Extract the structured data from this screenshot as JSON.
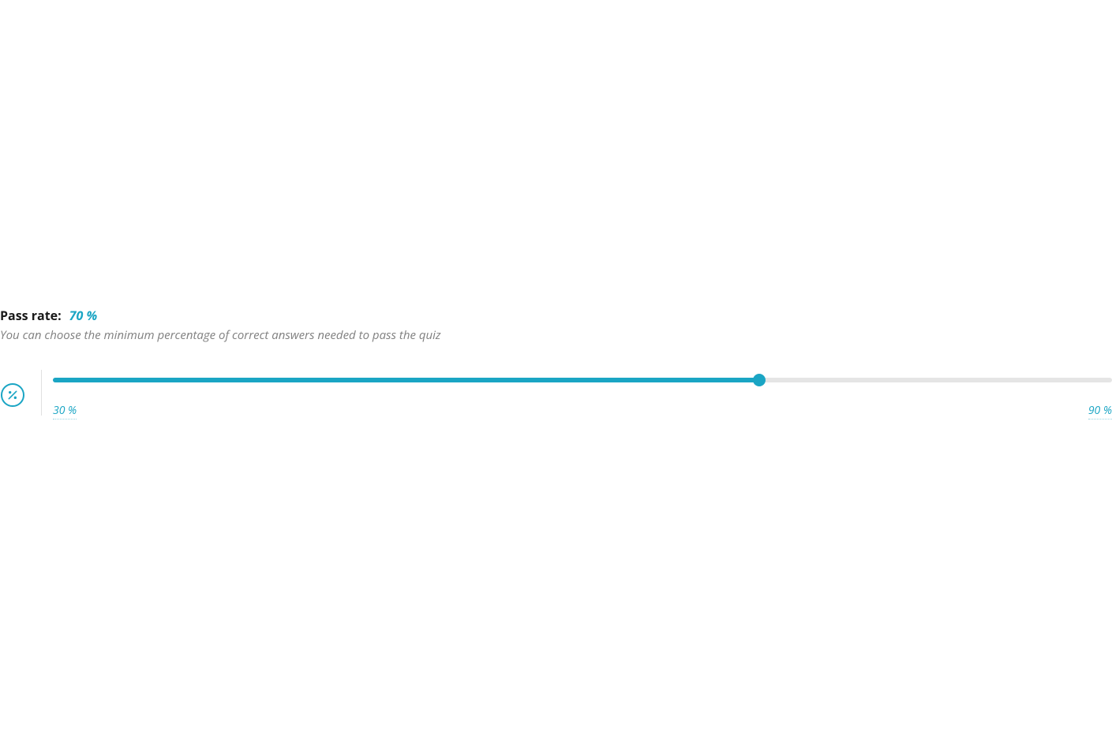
{
  "passRate": {
    "label": "Pass rate:",
    "value": "70 %",
    "description": "You can choose the minimum percentage of correct answers needed to pass the quiz",
    "slider": {
      "min": 30,
      "max": 90,
      "current": 70,
      "minLabel": "30 %",
      "maxLabel": "90 %",
      "fillPercent": 66.67
    }
  },
  "colors": {
    "accent": "#1aa5c4",
    "trackEmpty": "#e5e5e5",
    "textMuted": "#808080"
  }
}
